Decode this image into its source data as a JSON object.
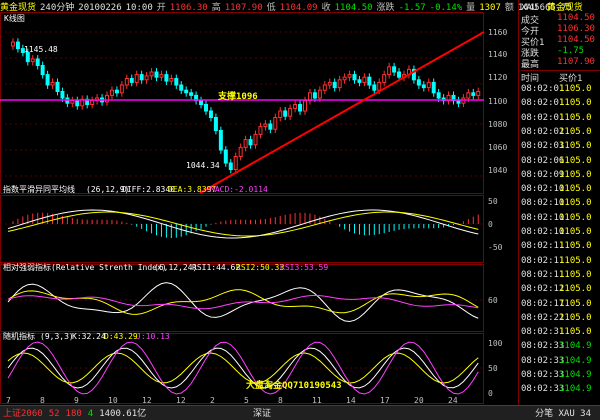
{
  "header": {
    "instrument": "黄金现货",
    "period": "240分钟",
    "date": "20100226",
    "time": "10:00",
    "open_label": "开",
    "open": "1106.30",
    "high_label": "高",
    "high": "1107.90",
    "low_label": "低",
    "low": "1104.09",
    "close_label": "收",
    "close": "1104.50",
    "change_label": "涨跌",
    "change": "-1.57",
    "pct": "-0.14%",
    "vol_label": "量",
    "vol": "1307",
    "oi_label": "额",
    "oi": "1445665.75"
  },
  "main_chart": {
    "label": "K线图",
    "y_ticks": [
      "1160",
      "1140",
      "1120",
      "1100",
      "1080",
      "1060",
      "1040"
    ],
    "annotation_high": "1145.48",
    "annotation_low": "1044.34",
    "support_label": "支撑1096"
  },
  "macd": {
    "title": "指数平滑异同平均线",
    "params": "(26,12,9)",
    "diff": "DIFF:2.8340",
    "dea": "DEA:3.8397",
    "macd": "MACD:-2.0114",
    "y_ticks": [
      "50",
      "0",
      "-50"
    ]
  },
  "rsi": {
    "title": "相对强弱指标(Relative Strenth Index)",
    "params": "(6,12,24)",
    "rsi1": "RSI1:44.62",
    "rsi2": "RSI2:50.33",
    "rsi3": "RSI3:53.59",
    "y_ticks": [
      "60"
    ]
  },
  "kdj": {
    "title": "随机指标",
    "params": "(9,3,3)",
    "k": "K:32.24",
    "d": "D:43.29",
    "j": "J:10.13",
    "y_ticks": [
      "100",
      "50",
      "0"
    ],
    "watermark": "大盘淘金QQ710190543"
  },
  "x_ticks": [
    "7",
    "8",
    "9",
    "10",
    "12",
    "12",
    "2",
    "5",
    "8",
    "11",
    "14",
    "17",
    "20",
    "24"
  ],
  "side": {
    "symbol": "XAU",
    "name": "黄金现货",
    "fields": [
      {
        "label": "成交",
        "value": "1104.50"
      },
      {
        "label": "今开",
        "value": "1106.30"
      },
      {
        "label": "买价1",
        "value": "1104.50"
      },
      {
        "label": "涨跌",
        "value": "-1.75"
      },
      {
        "label": "最高",
        "value": "1107.90"
      }
    ],
    "time_header": "时间",
    "price_header": "买价1",
    "ticks": [
      {
        "t": "08:02:01",
        "p": "1105.0"
      },
      {
        "t": "08:02:01",
        "p": "1105.0"
      },
      {
        "t": "08:02:01",
        "p": "1105.0"
      },
      {
        "t": "08:02:02",
        "p": "1105.0"
      },
      {
        "t": "08:02:03",
        "p": "1105.0"
      },
      {
        "t": "08:02:06",
        "p": "1105.0"
      },
      {
        "t": "08:02:09",
        "p": "1105.0"
      },
      {
        "t": "08:02:10",
        "p": "1105.0"
      },
      {
        "t": "08:02:10",
        "p": "1105.0"
      },
      {
        "t": "08:02:10",
        "p": "1105.0"
      },
      {
        "t": "08:02:10",
        "p": "1105.0"
      },
      {
        "t": "08:02:11",
        "p": "1105.0"
      },
      {
        "t": "08:02:11",
        "p": "1105.0"
      },
      {
        "t": "08:02:11",
        "p": "1105.0"
      },
      {
        "t": "08:02:12",
        "p": "1105.0"
      },
      {
        "t": "08:02:17",
        "p": "1105.0"
      },
      {
        "t": "08:02:22",
        "p": "1105.0"
      },
      {
        "t": "08:02:31",
        "p": "1105.0"
      },
      {
        "t": "08:02:33",
        "p": "1104.9"
      },
      {
        "t": "08:02:33",
        "p": "1104.9"
      },
      {
        "t": "08:02:33",
        "p": "1104.9"
      },
      {
        "t": "08:02:33",
        "p": "1104.9"
      }
    ]
  },
  "bottom": {
    "left": "上证2060",
    "items": [
      "52",
      "180",
      "4",
      "1400.61亿"
    ],
    "right": "深证",
    "tail": "分笔 XAU 34"
  },
  "colors": {
    "up": "#ff3030",
    "down": "#00ffff",
    "frame": "#800000",
    "trend": "#ff0000",
    "support": "#ff00ff"
  }
}
